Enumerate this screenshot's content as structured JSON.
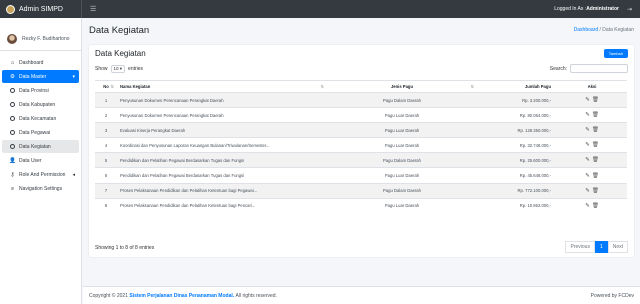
{
  "topbar": {
    "brand": "Admin SIMPD",
    "logged_prefix": "Logged In As : ",
    "logged_user": "Administrator"
  },
  "sidebar": {
    "user": "Rezky F. Budihartono",
    "items": [
      {
        "label": "Dashboard",
        "icon": "home-icon"
      },
      {
        "label": "Data Master",
        "icon": "gears-icon"
      },
      {
        "label": "Data Provinsi"
      },
      {
        "label": "Data Kabupaten"
      },
      {
        "label": "Data Kecamatan"
      },
      {
        "label": "Data Pegawai"
      },
      {
        "label": "Data Kegiatan"
      },
      {
        "label": "Data User",
        "icon": "user-icon"
      },
      {
        "label": "Role And Permission",
        "icon": "user-shield-icon"
      },
      {
        "label": "Navigation Settings",
        "icon": "bars-icon"
      }
    ]
  },
  "page": {
    "title": "Data Kegiatan",
    "crumb_home": "Dashboard",
    "crumb_sep": "/",
    "crumb_current": "Data Kegiatan"
  },
  "card": {
    "title": "Data Kegiatan",
    "add_label": "Tambah",
    "show_label": "Show",
    "entries_value": "10",
    "entries_label": "entries",
    "search_label": "Search:"
  },
  "table": {
    "headers": {
      "no": "No",
      "nama": "Nama Kegiatan",
      "jenis": "Jenis Pagu",
      "jumlah": "Jumlah Pagu",
      "aksi": "Aksi"
    },
    "rows": [
      {
        "no": "1",
        "nama": "Penyusunan Dokumen Perencanaan Perangkat Daerah",
        "jenis": "Pagu Dalam Daerah",
        "jumlah": "Rp. 3.200.000,-"
      },
      {
        "no": "2",
        "nama": "Penyusunan Dokumen Perencanaan Perangkat Daerah",
        "jenis": "Pagu Luar Daerah",
        "jumlah": "Rp. 80.064.000,-"
      },
      {
        "no": "3",
        "nama": "Evaluasi Kinerja Perangkat Daerah",
        "jenis": "Pagu Luar Daerah",
        "jumlah": "Rp. 128.350.000,-"
      },
      {
        "no": "4",
        "nama": "Koordinasi dan Penyusunan Laporan Keuangan Bulanan/Triwulanan/Semester...",
        "jenis": "Pagu Luar Daerah",
        "jumlah": "Rp. 32.748.000,-"
      },
      {
        "no": "5",
        "nama": "Pendidikan dan Pelatihan Pegawai Berdasarkan Tugas dan Fungsi",
        "jenis": "Pagu Dalam Daerah",
        "jumlah": "Rp. 25.600.000,-"
      },
      {
        "no": "6",
        "nama": "Pendidikan dan Pelatihan Pegawai Berdasarkan Tugas dan Fungsi",
        "jenis": "Pagu Luar Daerah",
        "jumlah": "Rp. 45.648.000,-"
      },
      {
        "no": "7",
        "nama": "Proses Pelaksanaan Pendidikan dan Pelatihan Ketentuan bagi Pegawai...",
        "jenis": "Pagu Dalam Daerah",
        "jumlah": "Rp. 772.100.000,-"
      },
      {
        "no": "8",
        "nama": "Proses Pelaksanaan Pendidikan dan Pelatihan Ketentuan bagi Pencari...",
        "jenis": "Pagu Luar Daerah",
        "jumlah": "Rp. 10.862.000,-"
      }
    ]
  },
  "pagination": {
    "info": "Showing 1 to 8 of 8 entries",
    "previous": "Previous",
    "page": "1",
    "next": "Next"
  },
  "footer": {
    "copyright": "Copyright © 2021",
    "app_name": "Sistem Perjalanan Dinas Penanaman Modal.",
    "rights": "All rights reserved.",
    "powered": "Powered by FCDev"
  }
}
